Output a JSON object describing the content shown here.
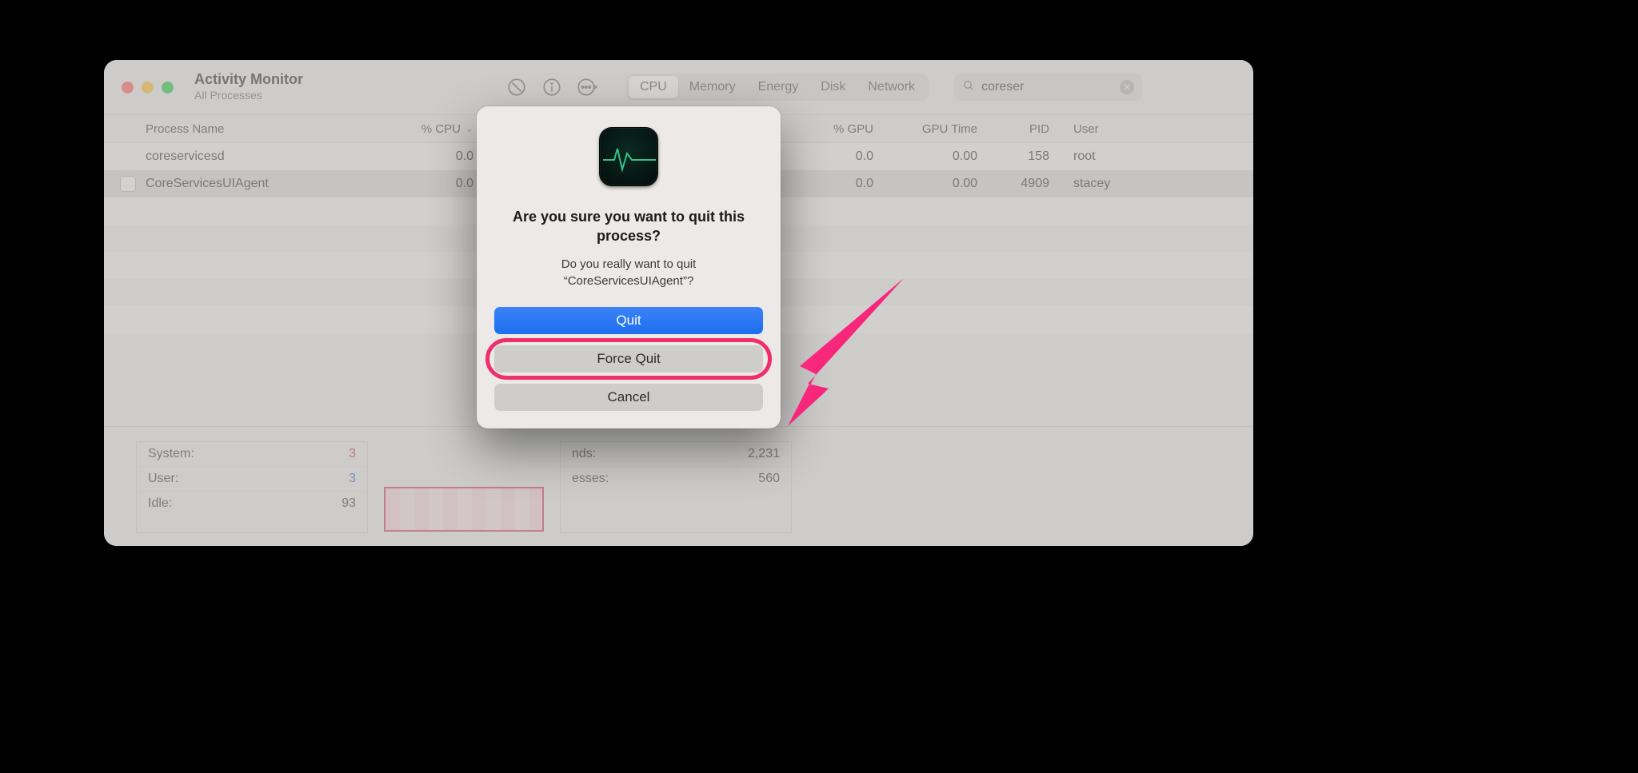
{
  "window": {
    "title": "Activity Monitor",
    "subtitle": "All Processes"
  },
  "tabs": {
    "items": [
      "CPU",
      "Memory",
      "Energy",
      "Disk",
      "Network"
    ],
    "selected": "CPU"
  },
  "search": {
    "value": "coreser"
  },
  "columns": {
    "name": "Process Name",
    "cpu": "% CPU",
    "gpu": "% GPU",
    "gputime": "GPU Time",
    "pid": "PID",
    "user": "User"
  },
  "rows": [
    {
      "name": "coreservicesd",
      "cpu": "0.0",
      "gpu": "0.0",
      "gputime": "0.00",
      "pid": "158",
      "user": "root"
    },
    {
      "name": "CoreServicesUIAgent",
      "cpu": "0.0",
      "gpu": "0.0",
      "gputime": "0.00",
      "pid": "4909",
      "user": "stacey"
    }
  ],
  "stats": {
    "left": [
      {
        "label": "System:",
        "value": "3",
        "cls": "red"
      },
      {
        "label": "User:",
        "value": "3",
        "cls": "blue"
      },
      {
        "label": "Idle:",
        "value": "93",
        "cls": ""
      }
    ],
    "right": [
      {
        "label": "Threads:",
        "value": "2,231"
      },
      {
        "label": "Processes:",
        "value": "560"
      }
    ],
    "right_label_suffix": {
      "threads": "nds:",
      "processes": "esses:"
    }
  },
  "dialog": {
    "title": "Are you sure you want to quit this process?",
    "message": "Do you really want to quit “CoreServicesUIAgent”?",
    "buttons": {
      "quit": "Quit",
      "force_quit": "Force Quit",
      "cancel": "Cancel"
    }
  },
  "annotation": {
    "highlight_target": "force-quit-button",
    "color": "#ef2e6b"
  }
}
